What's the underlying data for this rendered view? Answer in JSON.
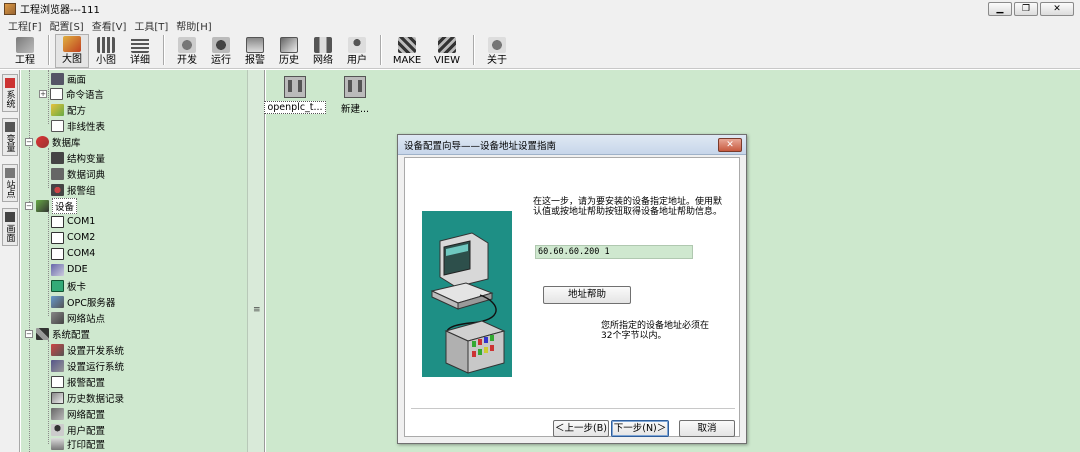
{
  "window": {
    "title": "工程浏览器---111"
  },
  "menus": [
    "工程[F]",
    "配置[S]",
    "查看[V]",
    "工具[T]",
    "帮助[H]"
  ],
  "toolbar": {
    "groups": [
      [
        {
          "label": "工程"
        }
      ],
      [
        {
          "label": "大图"
        },
        {
          "label": "小图"
        },
        {
          "label": "详细"
        }
      ],
      [
        {
          "label": "开发"
        },
        {
          "label": "运行"
        },
        {
          "label": "报警"
        },
        {
          "label": "历史"
        },
        {
          "label": "网络"
        },
        {
          "label": "用户"
        }
      ],
      [
        {
          "label": "MAKE"
        },
        {
          "label": "VIEW"
        }
      ],
      [
        {
          "label": "关于"
        }
      ]
    ]
  },
  "side_tabs": [
    {
      "label": "系统"
    },
    {
      "label": "变量"
    },
    {
      "label": "站点"
    },
    {
      "label": "画面"
    }
  ],
  "tree": {
    "items": [
      {
        "label": "画面"
      },
      {
        "label": "命令语言"
      },
      {
        "label": "配方"
      },
      {
        "label": "非线性表"
      },
      {
        "label": "数据库"
      },
      {
        "label": "结构变量"
      },
      {
        "label": "数据词典"
      },
      {
        "label": "报警组"
      },
      {
        "label": "设备"
      },
      {
        "label": "COM1"
      },
      {
        "label": "COM2"
      },
      {
        "label": "COM4"
      },
      {
        "label": "DDE"
      },
      {
        "label": "板卡"
      },
      {
        "label": "OPC服务器"
      },
      {
        "label": "网络站点"
      },
      {
        "label": "系统配置"
      },
      {
        "label": "设置开发系统"
      },
      {
        "label": "设置运行系统"
      },
      {
        "label": "报警配置"
      },
      {
        "label": "历史数据记录"
      },
      {
        "label": "网络配置"
      },
      {
        "label": "用户配置"
      },
      {
        "label": "打印配置"
      }
    ]
  },
  "content": {
    "items": [
      {
        "label": "openplc_t..."
      },
      {
        "label": "新建..."
      }
    ]
  },
  "dialog": {
    "title": "设备配置向导——设备地址设置指南",
    "close": "✕",
    "description": "在这一步，请为要安装的设备指定地址。使用默认值或按地址帮助按钮取得设备地址帮助信息。",
    "address_value": "60.60.60.200 1",
    "address_help": "地址帮助",
    "note": "您所指定的设备地址必须在32个字节以内。",
    "prev": "＜上一步(B)",
    "next": "下一步(N)＞",
    "cancel": "取消"
  }
}
